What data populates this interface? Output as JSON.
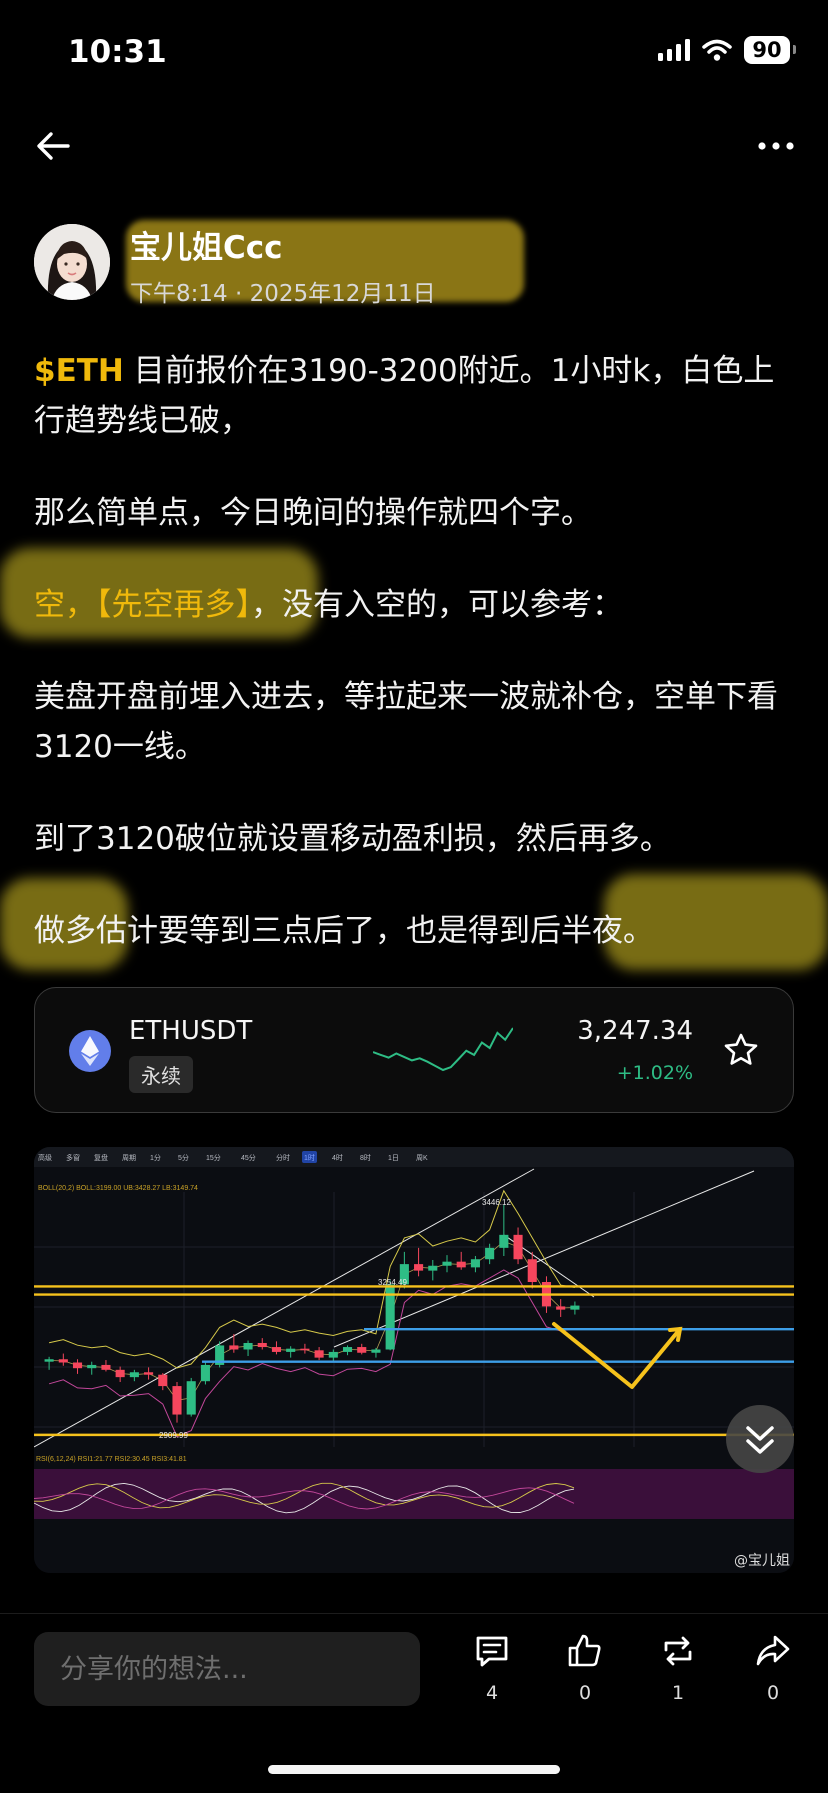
{
  "status_bar": {
    "time": "10:31",
    "battery": "90"
  },
  "author": {
    "name": "宝儿姐Ccc",
    "time": "下午8:14",
    "date": "2025年12月11日"
  },
  "post": {
    "p1_ticker": "$ETH",
    "p1_text": " 目前报价在3190-3200附近。1小时k，白色上行趋势线已破，",
    "p2": "那么简单点，今日晚间的操作就四个字。",
    "p3_accent": "空，【先空再多】",
    "p3_text": "，没有入空的，可以参考：",
    "p4": "美盘开盘前埋入进去，等拉起来一波就补仓，空单下看3120一线。",
    "p5": "到了3120破位就设置移动盈利损，然后再多。",
    "p6_a": "做多估计要等到三点后了，也是得到",
    "p6_b": "后半夜。"
  },
  "ticker_card": {
    "pair": "ETHUSDT",
    "contract_type": "永续",
    "price": "3,247.34",
    "change": "+1.02%",
    "up_color": "#2ebd85",
    "sparkline": [
      3212,
      3208,
      3204,
      3210,
      3205,
      3200,
      3203,
      3198,
      3192,
      3186,
      3190,
      3202,
      3214,
      3208,
      3226,
      3218,
      3240,
      3230,
      3247
    ]
  },
  "chart_image": {
    "toolbar": [
      "高级",
      "多窗",
      "复盘",
      "周期",
      "1分",
      "5分",
      "15分",
      "45分",
      "分时",
      "1时",
      "4时",
      "8时",
      "1日",
      "周K"
    ],
    "indicator_line": "BOLL(20,2) BOLL:3199.00 UB:3428.27 LB:3149.74",
    "high_label": "3446.12",
    "level_label": "3254.49",
    "low_label": "2909.99",
    "rsi_line": "RSI(6,12,24) RSI1:21.77 RSI2:30.45 RSI3:41.81",
    "candles": [
      [
        3060,
        3072,
        3040,
        3066
      ],
      [
        3066,
        3080,
        3050,
        3058
      ],
      [
        3058,
        3066,
        3030,
        3044
      ],
      [
        3044,
        3060,
        3028,
        3052
      ],
      [
        3052,
        3064,
        3036,
        3040
      ],
      [
        3040,
        3048,
        3010,
        3022
      ],
      [
        3022,
        3040,
        3012,
        3034
      ],
      [
        3034,
        3046,
        3016,
        3028
      ],
      [
        3028,
        3032,
        2990,
        3000
      ],
      [
        3000,
        3010,
        2910,
        2930
      ],
      [
        2930,
        3020,
        2925,
        3012
      ],
      [
        3012,
        3060,
        3004,
        3052
      ],
      [
        3052,
        3110,
        3046,
        3100
      ],
      [
        3100,
        3128,
        3082,
        3090
      ],
      [
        3090,
        3112,
        3074,
        3106
      ],
      [
        3106,
        3118,
        3090,
        3096
      ],
      [
        3096,
        3110,
        3078,
        3084
      ],
      [
        3084,
        3098,
        3070,
        3092
      ],
      [
        3092,
        3104,
        3080,
        3088
      ],
      [
        3088,
        3096,
        3064,
        3070
      ],
      [
        3070,
        3090,
        3060,
        3084
      ],
      [
        3084,
        3100,
        3076,
        3096
      ],
      [
        3096,
        3104,
        3078,
        3082
      ],
      [
        3082,
        3094,
        3070,
        3090
      ],
      [
        3090,
        3260,
        3088,
        3250
      ],
      [
        3250,
        3330,
        3240,
        3300
      ],
      [
        3300,
        3340,
        3270,
        3284
      ],
      [
        3284,
        3310,
        3260,
        3296
      ],
      [
        3296,
        3322,
        3280,
        3306
      ],
      [
        3306,
        3330,
        3286,
        3292
      ],
      [
        3292,
        3320,
        3280,
        3312
      ],
      [
        3312,
        3350,
        3300,
        3340
      ],
      [
        3340,
        3446,
        3320,
        3372
      ],
      [
        3372,
        3390,
        3300,
        3312
      ],
      [
        3312,
        3330,
        3240,
        3256
      ],
      [
        3256,
        3270,
        3180,
        3196
      ],
      [
        3196,
        3214,
        3170,
        3188
      ],
      [
        3188,
        3208,
        3176,
        3198
      ]
    ],
    "yellow_levels": [
      3245,
      3225,
      2880
    ],
    "blue_levels": [
      3140,
      3060
    ]
  },
  "bottom_bar": {
    "share_placeholder": "分享你的想法...",
    "comments": "4",
    "likes": "0",
    "reposts": "1",
    "shares": "0"
  },
  "watermark": "@宝儿姐"
}
